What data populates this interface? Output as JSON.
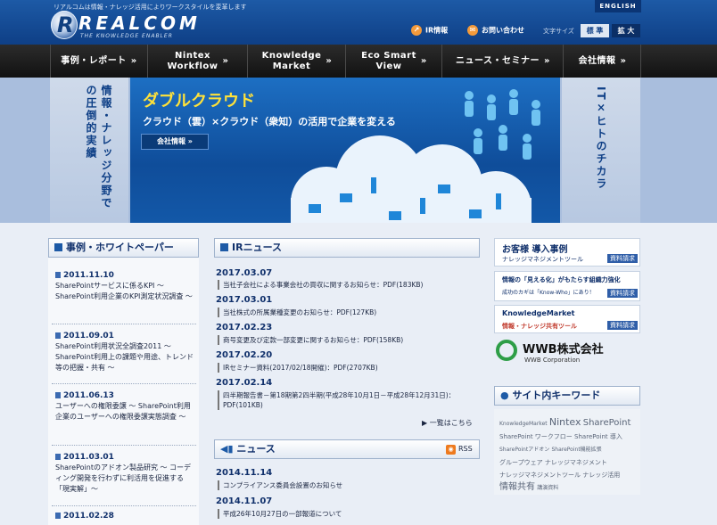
{
  "header": {
    "tagline": "リアルコムは情報・ナレッジ活用によりワークスタイルを変革します",
    "logo_letter": "R",
    "logo_word": "REALCOM",
    "logo_sub": "THE KNOWLEDGE ENABLER",
    "english_label": "ENGLISH",
    "ir_label": "IR情報",
    "contact_label": "お問い合わせ",
    "size_label": "文字サイズ",
    "size_standard": "標 準",
    "size_large": "拡 大"
  },
  "nav": [
    {
      "label": "事例・レポート"
    },
    {
      "label": "Nintex\nWorkflow"
    },
    {
      "label": "Knowledge\nMarket"
    },
    {
      "label": "Eco Smart\nView"
    },
    {
      "label": "ニュース・セミナー"
    },
    {
      "label": "会社情報"
    }
  ],
  "nav_chevron": "»",
  "hero": {
    "left_text": "情報・ナレッジ分野での圧倒的実績",
    "right_text": "IT×ヒトのチカラ",
    "title": "ダブルクラウド",
    "subtitle": "クラウド（雲）×クラウド（衆知）の活用で企業を変える",
    "button": "会社情報 »"
  },
  "left": {
    "heading": "事例・ホワイトペーパー",
    "items": [
      {
        "date": "2011.11.10",
        "text": "SharePointサービスに係るKPI ～ SharePoint利用企業のKPI測定状況調査 ～"
      },
      {
        "date": "2011.09.01",
        "text": "SharePoint利用状況全調査2011 ～ SharePoint利用上の課題や用途、トレンド等の把握・共有 ～"
      },
      {
        "date": "2011.06.13",
        "text": "ユーザーへの権限委譲 ～ SharePoint利用企業のユーザーへの権限委譲実態調査 ～"
      },
      {
        "date": "2011.03.01",
        "text": "SharePointのアドオン製品研究 ～ コーディング開発を行わずに利活用を促進する「現実解」～"
      },
      {
        "date": "2011.02.28",
        "text": ""
      }
    ]
  },
  "ir": {
    "heading": "IRニュース",
    "items": [
      {
        "date": "2017.03.07",
        "text": "当社子会社による事業会社の買収に関するお知らせ：PDF(183KB)"
      },
      {
        "date": "2017.03.01",
        "text": "当社株式の所属業種変更のお知らせ：PDF(127KB)"
      },
      {
        "date": "2017.02.23",
        "text": "商号変更及び定款一部変更に関するお知らせ：PDF(158KB)"
      },
      {
        "date": "2017.02.20",
        "text": "IRセミナー資料(2017/02/18開催)：PDF(2707KB)"
      },
      {
        "date": "2017.02.14",
        "text": "四半期報告書－第18期第2四半期(平成28年10月1日－平成28年12月31日)：PDF(101KB)"
      }
    ],
    "more": "一覧はこちら"
  },
  "news": {
    "heading": "ニュース",
    "rss": "RSS",
    "items": [
      {
        "date": "2014.11.14",
        "text": "コンプライアンス委員会設置のお知らせ"
      },
      {
        "date": "2014.11.07",
        "text": "平成26年10月27日の一部報道について"
      }
    ]
  },
  "right": {
    "promo1_title": "お客様 導入事例",
    "promo1_sub": "ナレッジマネジメントツール",
    "promo1_tag": "資料請求",
    "promo2_title": "情報の「見える化」がもたらす組織力強化",
    "promo2_sub": "成功のカギは「Know-Who」にあり！",
    "promo2_tag": "資料請求",
    "promo3_title": "KnowledgeMarket",
    "promo3_sub": "情報・ナレッジ共有ツール",
    "promo3_tag": "資料請求",
    "wwb_name": "WWB株式会社",
    "wwb_sub": "WWB Corporation",
    "kw_heading": "サイト内キーワード",
    "keywords": [
      "KnowledgeMarket",
      "Nintex",
      "SharePoint",
      "SharePoint ワークフロー",
      "SharePoint 導入",
      "SharePointアドオン",
      "SharePoint機能拡張",
      "グループウェア",
      "ナレッジマネジメント",
      "ナレッジマネジメントツール",
      "ナレッジ活用",
      "情報共有",
      "講演資料"
    ]
  },
  "colors": {
    "header": "#1d5aa6",
    "nav": "#1a1a1a",
    "accent_yellow": "#ffe23a"
  }
}
